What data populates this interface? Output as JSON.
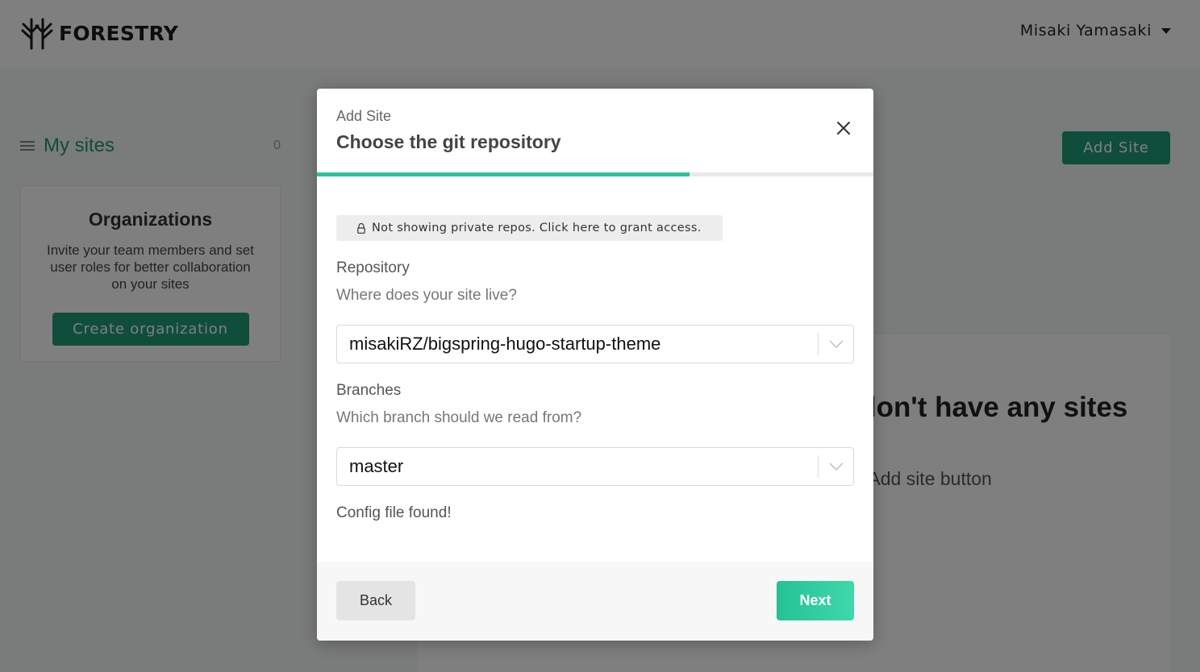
{
  "header": {
    "brand": "FORESTRY",
    "user_name": "Misaki Yamasaki"
  },
  "sidebar": {
    "my_sites_label": "My sites",
    "my_sites_count": "0",
    "org_card": {
      "title": "Organizations",
      "description": "Invite your team members and set user roles for better collaboration on your sites",
      "button_label": "Create organization"
    }
  },
  "main": {
    "add_site_label": "Add Site",
    "empty_title": "You don't have any sites yet",
    "empty_sub": "Use the Add site button"
  },
  "modal": {
    "kicker": "Add Site",
    "title": "Choose the git repository",
    "progress": 0.67,
    "notice": "Not showing private repos. Click here to grant access.",
    "repo_label": "Repository",
    "repo_help": "Where does your site live?",
    "repo_value": "misakiRZ/bigspring-hugo-startup-theme",
    "branch_label": "Branches",
    "branch_help": "Which branch should we read from?",
    "branch_value": "master",
    "status": "Config file found!",
    "back_label": "Back",
    "next_label": "Next"
  },
  "colors": {
    "accent": "#1f9d77",
    "progress": "#2ec29a",
    "next_button": "#2fcf9f"
  },
  "icons": [
    "forestry-logo-icon",
    "caret-down-icon",
    "list-icon",
    "close-icon",
    "lock-icon",
    "chevron-down-icon"
  ]
}
